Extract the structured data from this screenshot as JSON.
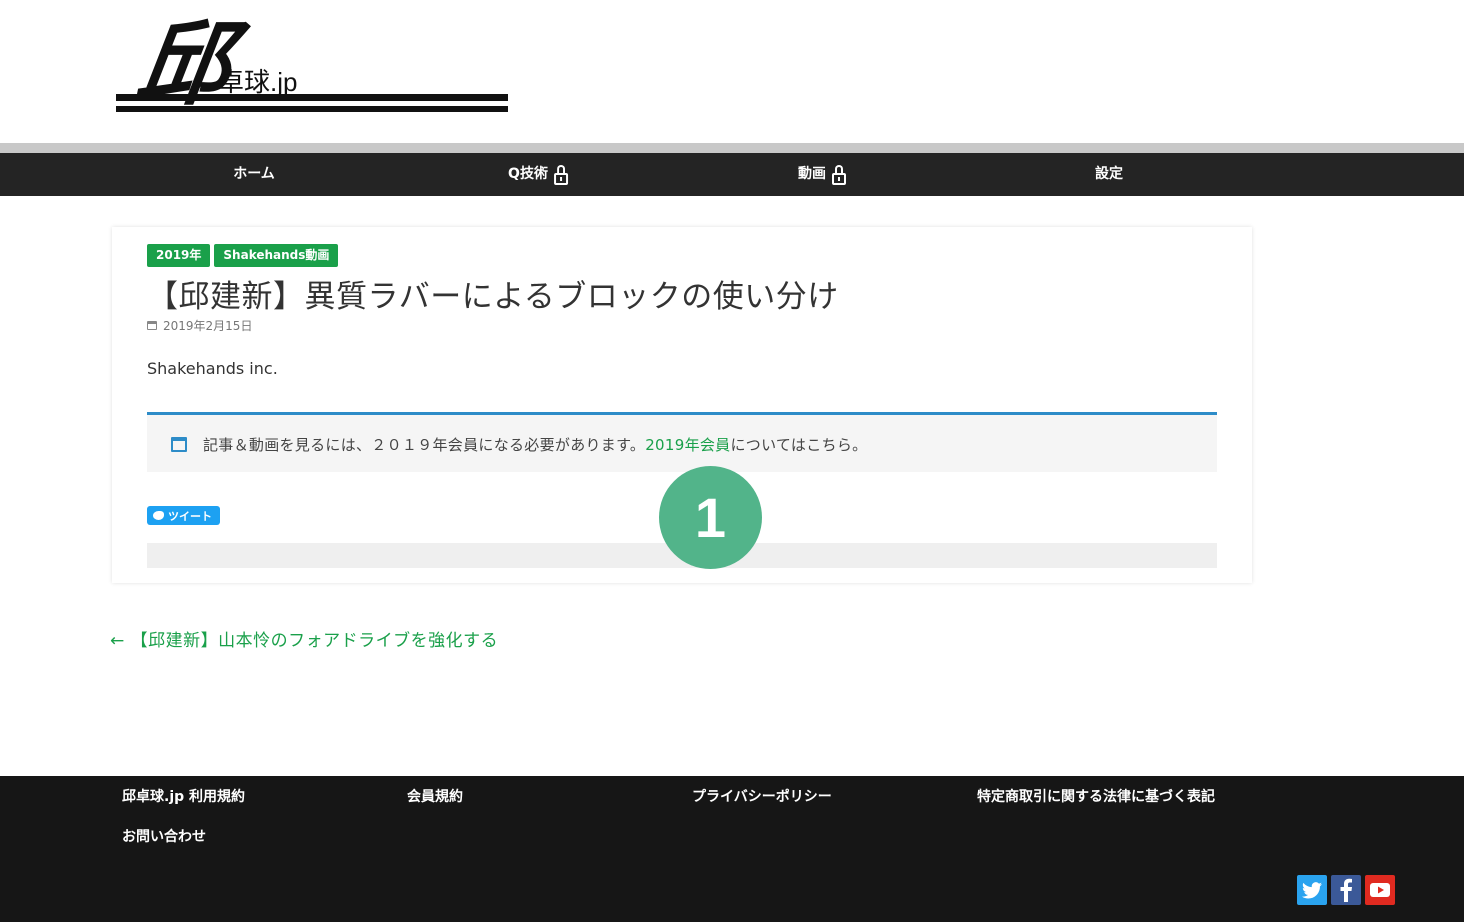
{
  "header": {
    "logo_kanji": "邱",
    "logo_name": "卓球.jp"
  },
  "nav": {
    "items": [
      {
        "label": "ホーム",
        "locked": false
      },
      {
        "label": "Q技術",
        "locked": true
      },
      {
        "label": "動画",
        "locked": true
      },
      {
        "label": "設定",
        "locked": false
      }
    ]
  },
  "post": {
    "tags": [
      "2019年",
      "Shakehands動画"
    ],
    "title": "【邱建新】異質ラバーによるブロックの使い分け",
    "date": "2019年2月15日",
    "author": "Shakehands inc.",
    "notice": {
      "before": "記事＆動画を見るには、２０１９年会員になる必要があります。",
      "link": "2019年会員",
      "after": "についてはこちら。"
    },
    "tweet_label": "ツイート",
    "step_number": "1"
  },
  "navigation": {
    "prev_link": "← 【邱建新】山本怜のフォアドライブを強化する"
  },
  "footer": {
    "links": [
      "邱卓球.jp 利用規約",
      "会員規約",
      "プライバシーポリシー",
      "特定商取引に関する法律に基づく表記",
      "お問い合わせ"
    ],
    "social": [
      "twitter-icon",
      "facebook-icon",
      "youtube-icon"
    ]
  },
  "colors": {
    "accent_green": "#1aa04a",
    "notice_blue": "#2d8cc8",
    "badge_green": "#52b48a",
    "nav_bg": "#242424",
    "footer_bg": "#161616"
  }
}
